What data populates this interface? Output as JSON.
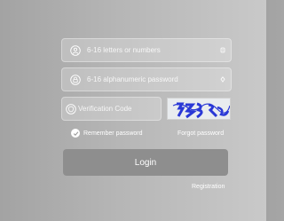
{
  "form": {
    "username": {
      "placeholder": "6-16 letters or numbers",
      "value": "",
      "lead_icon": "user-icon",
      "trail_icon": "info-icon"
    },
    "password": {
      "placeholder": "6-16 alphanumeric password",
      "value": "",
      "lead_icon": "lock-icon",
      "trail_icon": "eye-icon"
    },
    "captcha": {
      "placeholder": "Verification Code",
      "value": "",
      "lead_icon": "shield-icon",
      "image_alt": "captcha image"
    },
    "remember": {
      "label": "Remember password",
      "checked": true
    },
    "forgot_label": "Forgot password",
    "login_label": "Login",
    "register_label": "Registration"
  },
  "colors": {
    "captcha_text": "#2a38d6",
    "button_bg": "#8e8e8e"
  }
}
